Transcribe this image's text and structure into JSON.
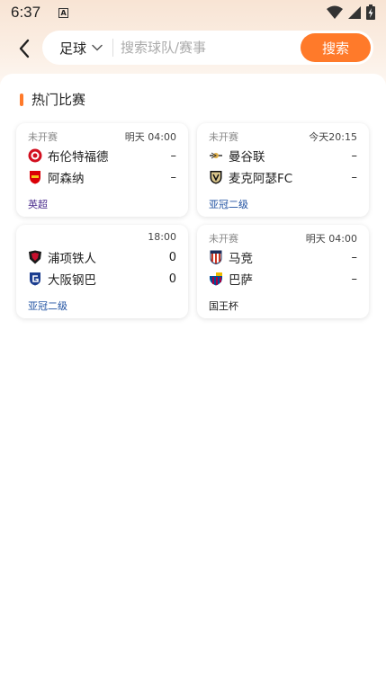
{
  "status_bar": {
    "time": "6:37",
    "notif_letter": "A"
  },
  "search": {
    "sport": "足球",
    "placeholder": "搜索球队/赛事",
    "button_label": "搜索"
  },
  "section_title": "热门比赛",
  "colors": {
    "accent": "#ff7a2a",
    "league_blue": "#1d4fa0",
    "league_purple": "#4a2b8c"
  },
  "matches": [
    {
      "status": "未开赛",
      "time": "明天 04:00",
      "home": {
        "name": "布伦特福德",
        "score": "–",
        "logo": "brentford-logo-icon"
      },
      "away": {
        "name": "阿森纳",
        "score": "–",
        "logo": "arsenal-logo-icon"
      },
      "league": "英超"
    },
    {
      "status": "未开赛",
      "time": "今天20:15",
      "home": {
        "name": "曼谷联",
        "score": "–",
        "logo": "bangkok-united-logo-icon"
      },
      "away": {
        "name": "麦克阿瑟FC",
        "score": "–",
        "logo": "macarthur-logo-icon"
      },
      "league": "亚冠二级"
    },
    {
      "status": "",
      "time": "18:00",
      "home": {
        "name": "浦项铁人",
        "score": "0",
        "logo": "pohang-logo-icon"
      },
      "away": {
        "name": "大阪钢巴",
        "score": "0",
        "logo": "gamba-osaka-logo-icon"
      },
      "league": "亚冠二级"
    },
    {
      "status": "未开赛",
      "time": "明天 04:00",
      "home": {
        "name": "马竞",
        "score": "–",
        "logo": "atletico-logo-icon"
      },
      "away": {
        "name": "巴萨",
        "score": "–",
        "logo": "barcelona-logo-icon"
      },
      "league": "国王杯"
    }
  ]
}
